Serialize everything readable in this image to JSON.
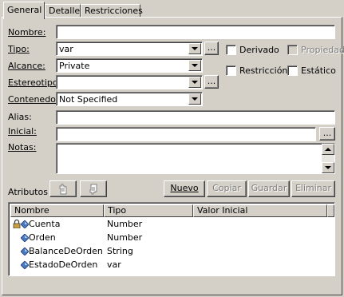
{
  "tabs": [
    {
      "label": "General",
      "active": true
    },
    {
      "label": "Detalle",
      "active": false
    },
    {
      "label": "Restricciones",
      "active": false
    }
  ],
  "form": {
    "nombre": {
      "label": "Nombre:",
      "value": ""
    },
    "tipo": {
      "label": "Tipo:",
      "value": "var"
    },
    "alcance": {
      "label": "Alcance:",
      "value": "Private"
    },
    "estereotipo": {
      "label": "Estereotipo:",
      "value": ""
    },
    "contenedor": {
      "label": "Contenedor:",
      "value": "Not Specified"
    },
    "alias": {
      "label": "Alias:",
      "value": ""
    },
    "inicial": {
      "label": "Inicial:",
      "value": ""
    },
    "notas": {
      "label": "Notas:",
      "value": ""
    }
  },
  "ellipsis": "...",
  "checkboxes": {
    "derivado": {
      "label": "Derivado",
      "checked": false,
      "enabled": true
    },
    "propiedad": {
      "label": "Propiedad",
      "checked": false,
      "enabled": false
    },
    "restriccion": {
      "label": "Restricción",
      "checked": false,
      "enabled": true
    },
    "estatico": {
      "label": "Estático",
      "checked": false,
      "enabled": true
    }
  },
  "atributos": {
    "label": "Atributos",
    "buttons": {
      "nuevo": "Nuevo",
      "copiar": "Copiar",
      "guardar": "Guardar",
      "eliminar": "Eliminar"
    },
    "columns": [
      "Nombre",
      "Tipo",
      "Valor Inicial"
    ],
    "rows": [
      {
        "nombre": "Cuenta",
        "tipo": "Number",
        "valor": "",
        "locked": true
      },
      {
        "nombre": "Orden",
        "tipo": "Number",
        "valor": "",
        "locked": false
      },
      {
        "nombre": "BalanceDeOrden",
        "tipo": "String",
        "valor": "",
        "locked": false
      },
      {
        "nombre": "EstadoDeOrden",
        "tipo": "var",
        "valor": "",
        "locked": false
      }
    ]
  },
  "colors": {
    "face": "#d4d0c8",
    "highlight": "#ffffff",
    "shadow": "#808080",
    "dark": "#404040"
  },
  "icons": [
    "lock-icon",
    "attribute-diamond-icon",
    "hand-up-icon",
    "hand-down-icon",
    "dropdown-arrow-icon"
  ]
}
